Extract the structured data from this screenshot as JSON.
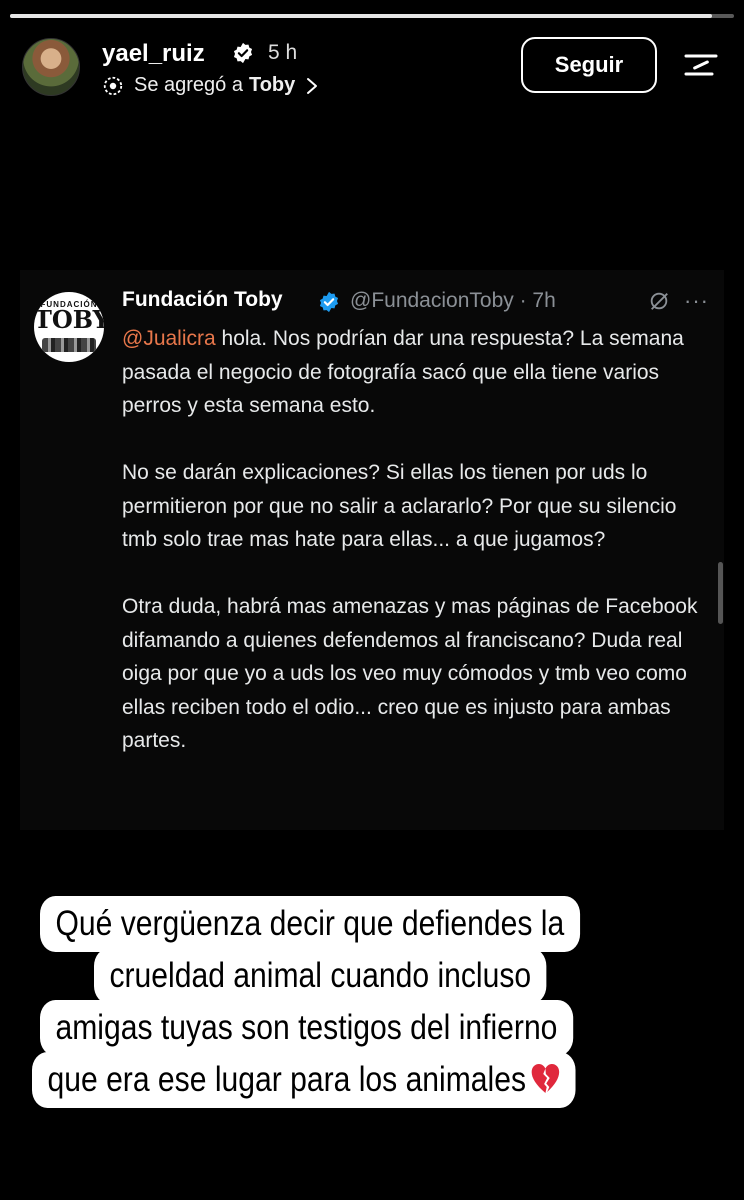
{
  "story": {
    "progress": 0.97,
    "username": "yael_ruiz",
    "time": "5 h",
    "added_prefix": "Se agregó a",
    "added_target": "Toby",
    "follow_label": "Seguir"
  },
  "tweet": {
    "name": "Fundación Toby",
    "handle": "@FundacionToby · 7h",
    "avatar_text_top": "FUNDACIÓN",
    "avatar_text_main": "TOBY",
    "mention": "@Jualicra",
    "paragraph1_rest": " hola. Nos podrían dar una respuesta? La semana pasada el negocio de fotografía sacó que ella tiene varios perros y esta semana esto.",
    "paragraph2": "No se darán explicaciones? Si ellas los tienen por uds lo permitieron por que no salir a aclararlo? Por que su silencio tmb solo trae mas hate para ellas... a que jugamos?",
    "paragraph3": "Otra duda, habrá mas amenazas y mas páginas de Facebook difamando a quienes defendemos al franciscano? Duda real oiga por que yo a uds los veo muy cómodos y tmb veo como ellas reciben todo el odio... creo que es injusto para ambas partes.",
    "more_label": "···"
  },
  "caption": {
    "lines": [
      "Qué vergüenza decir que defiendes la",
      "crueldad animal cuando incluso",
      "amigas tuyas son testigos del infierno",
      "que era ese lugar para los animales"
    ],
    "emoji": "broken-heart-icon"
  },
  "colors": {
    "background": "#000000",
    "mention": "#e8774b",
    "verified": "#1d9bf0",
    "handle": "#8b9096"
  }
}
